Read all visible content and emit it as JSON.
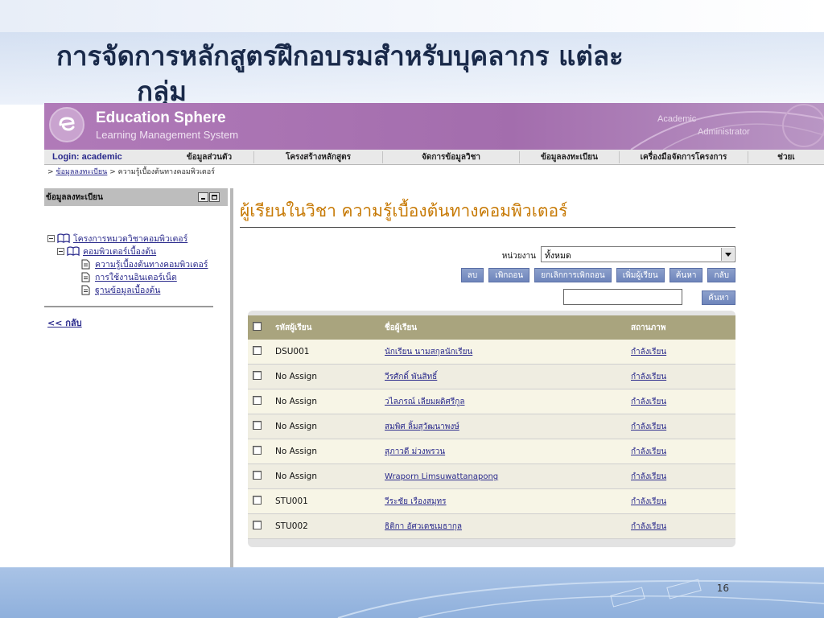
{
  "slide": {
    "title_line1": "การจัดการหลักสูตรฝึกอบรมสำหรับบุคลากร แต่ละ",
    "title_line2": "กลุ่ม",
    "page_number": "16"
  },
  "app": {
    "name": "Education Sphere",
    "subtitle": "Learning Management System",
    "role_line1": "Academic",
    "role_line2": "Administrator"
  },
  "menubar": {
    "login": "Login: academic",
    "items": [
      "ข้อมูลส่วนตัว",
      "โครงสร้างหลักสูตร",
      "จัดการข้อมูลวิชา",
      "ข้อมูลลงทะเบียน",
      "เครื่องมือจัดการโครงการ",
      "ช่วยเ"
    ]
  },
  "breadcrumb": {
    "prefix": ">",
    "link": "ข้อมูลลงทะเบียน",
    "separator": ">",
    "current": "ความรู้เบื้องต้นทางคอมพิวเตอร์"
  },
  "sidebar": {
    "title": "ข้อมูลลงทะเบียน",
    "tree": {
      "root": "โครงการหมวดวิชาคอมพิวเตอร์",
      "group": "คอมพิวเตอร์เบื้องต้น",
      "courses": [
        "ความรู้เบื้องต้นทางคอมพิวเตอร์",
        "การใช้งานอินเตอร์เน็ต",
        "ฐานข้อมูลเบื้องต้น"
      ]
    },
    "back": "<< กลับ"
  },
  "main": {
    "title": "ผู้เรียนในวิชา ความรู้เบื้องต้นทางคอมพิวเตอร์",
    "filter_label": "หน่วยงาน",
    "filter_value": "ทั้งหมด",
    "buttons": {
      "delete": "ลบ",
      "withdraw": "เพิกถอน",
      "cancel_withdraw": "ยกเลิกการเพิกถอน",
      "add_learner": "เพิ่มผู้เรียน",
      "search": "ค้นหา",
      "back": "กลับ"
    },
    "search_button": "ค้นหา",
    "table": {
      "headers": [
        "รหัสผู้เรียน",
        "ชื่อผู้เรียน",
        "สถานภาพ"
      ],
      "rows": [
        {
          "id": "DSU001",
          "name": "นักเรียน นามสกุลนักเรียน",
          "status": "กำลังเรียน"
        },
        {
          "id": "No Assign",
          "name": "วีรศักดิ์ พันสิทธิ์",
          "status": "กำลังเรียน"
        },
        {
          "id": "No Assign",
          "name": "วไลภรณ์ เลียมผดิศรีกูล",
          "status": "กำลังเรียน"
        },
        {
          "id": "No Assign",
          "name": "สมพิศ ลิ้มสุวัฒนาพงษ์",
          "status": "กำลังเรียน"
        },
        {
          "id": "No Assign",
          "name": "สุภาวดี ม่วงพรวน",
          "status": "กำลังเรียน"
        },
        {
          "id": "No Assign",
          "name": "Wraporn Limsuwattanapong",
          "status": "กำลังเรียน"
        },
        {
          "id": "STU001",
          "name": "วีระชัย เรืองสมุทร",
          "status": "กำลังเรียน"
        },
        {
          "id": "STU002",
          "name": "ธิติกา อัศวเดชเมธากุล",
          "status": "กำลังเรียน"
        }
      ]
    }
  }
}
